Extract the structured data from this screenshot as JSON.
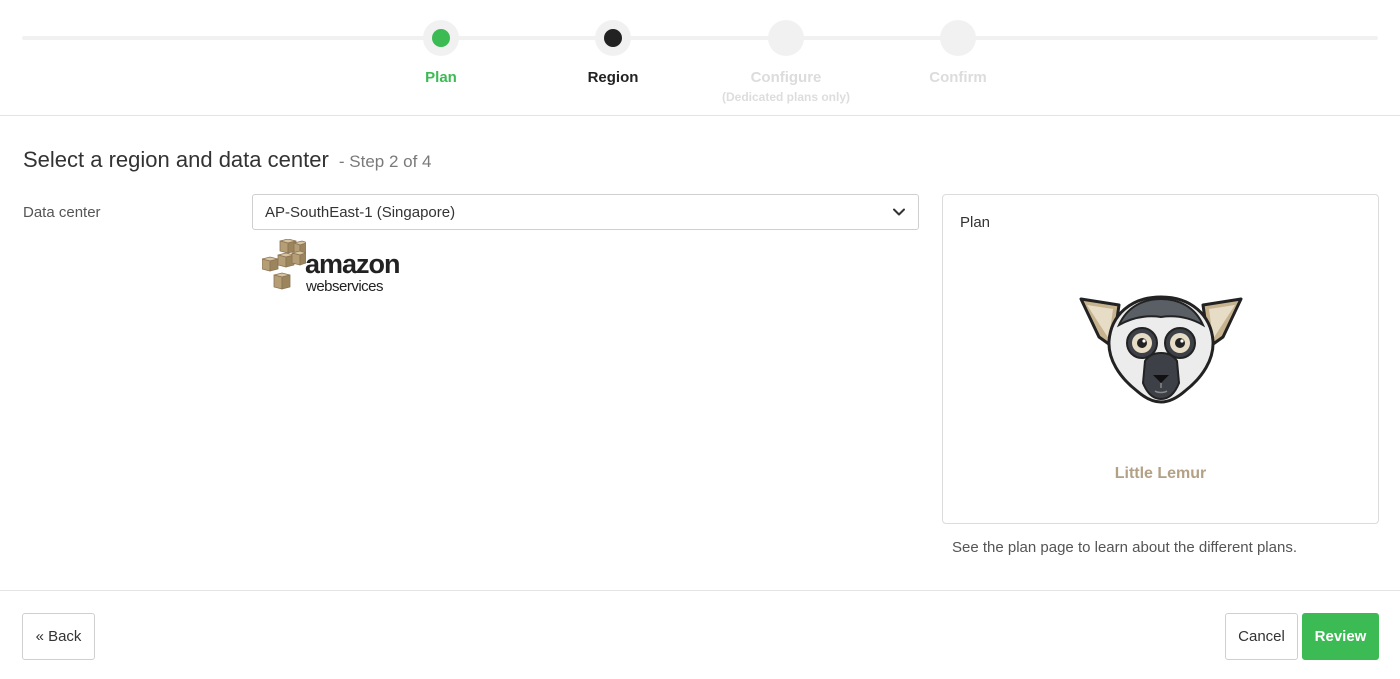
{
  "stepper": {
    "steps": [
      {
        "label": "Plan",
        "sublabel": "",
        "state": "done"
      },
      {
        "label": "Region",
        "sublabel": "",
        "state": "active"
      },
      {
        "label": "Configure",
        "sublabel": "(Dedicated plans only)",
        "state": "pending"
      },
      {
        "label": "Confirm",
        "sublabel": "",
        "state": "pending"
      }
    ]
  },
  "page": {
    "title": "Select a region and data center",
    "step_text": "- Step 2 of 4"
  },
  "data_center": {
    "label": "Data center",
    "selected": "AP-SouthEast-1 (Singapore)",
    "provider_logo": {
      "icon": "aws-logo",
      "text_main": "amazon",
      "text_sub": "webservices"
    }
  },
  "plan_card": {
    "title": "Plan",
    "plan_name": "Little Lemur",
    "icon": "lemur-icon",
    "hint": "See the plan page to learn about the different plans."
  },
  "footer": {
    "back_label": "« Back",
    "cancel_label": "Cancel",
    "review_label": "Review"
  },
  "colors": {
    "accent": "#3cba54",
    "plan_name": "#b3a186"
  }
}
